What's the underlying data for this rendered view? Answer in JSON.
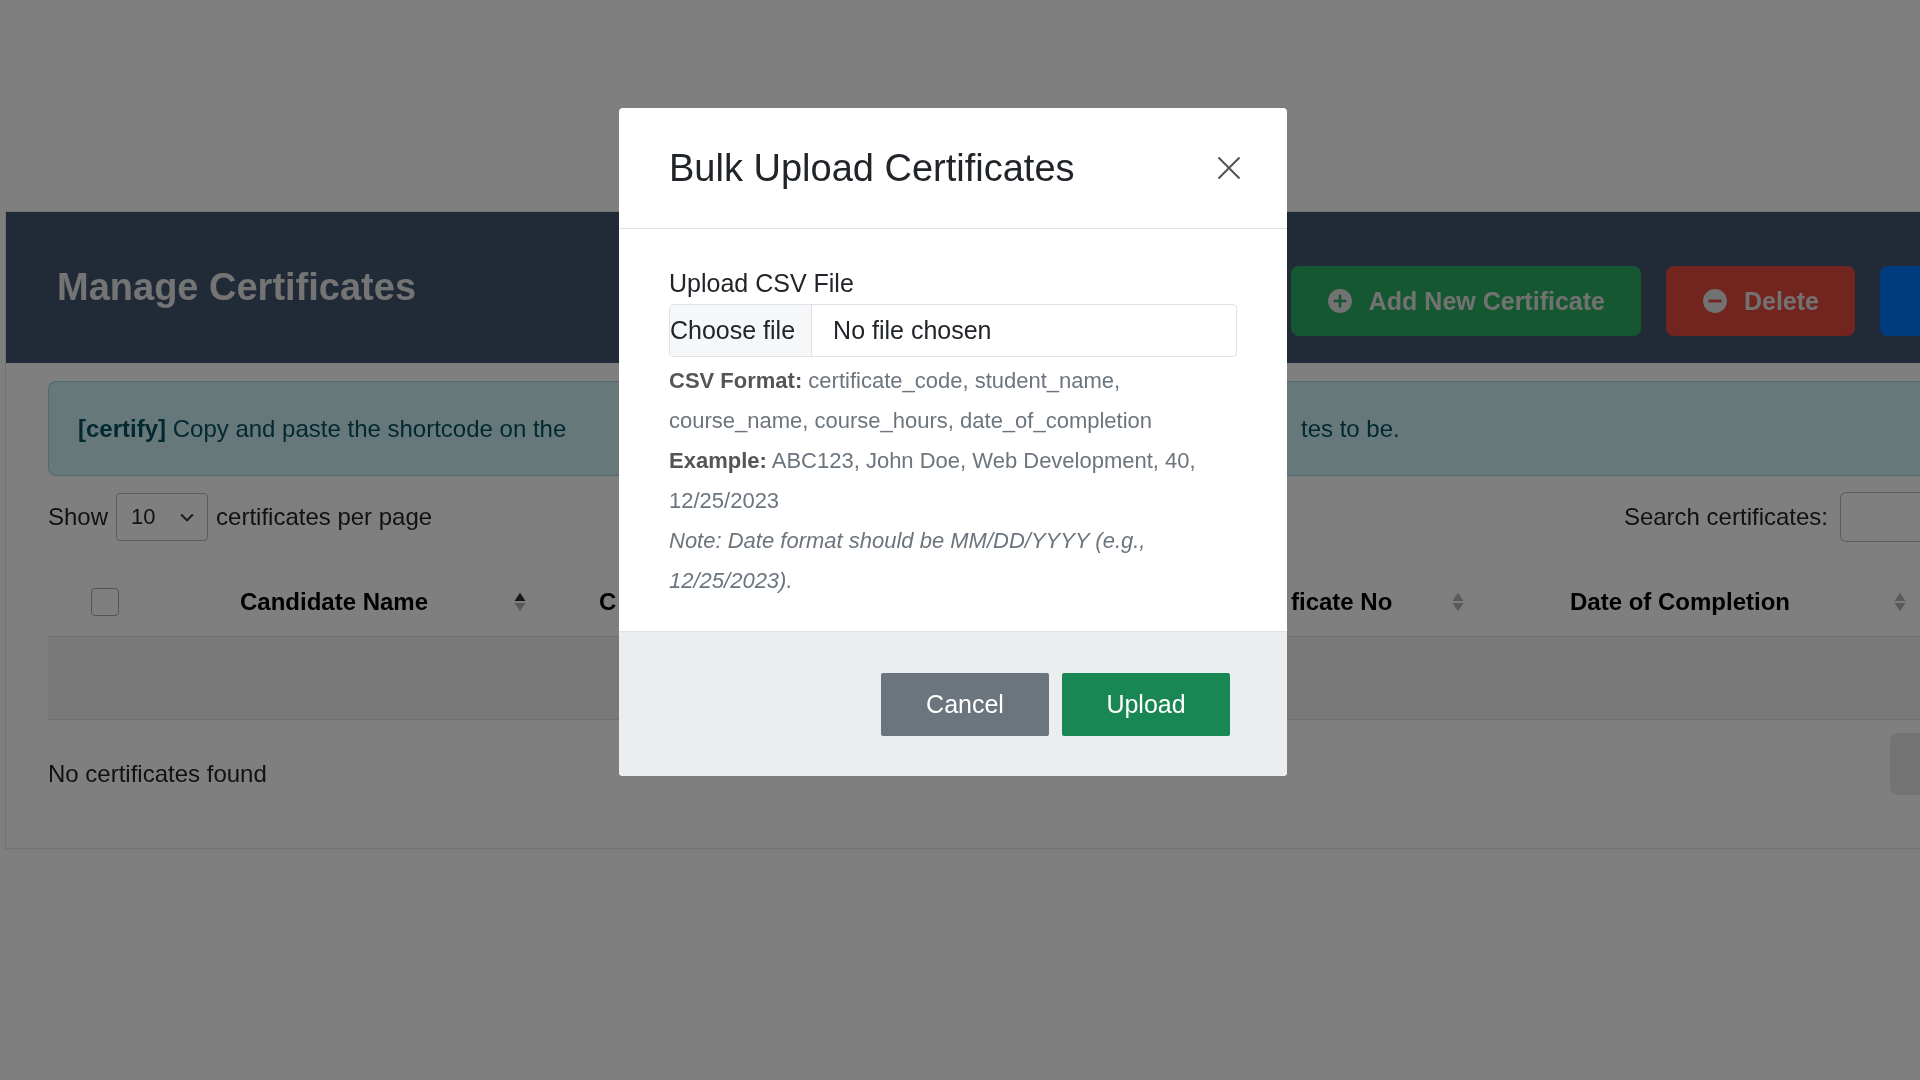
{
  "page": {
    "title": "Manage Certificates",
    "actions": [
      {
        "kind": "add",
        "label": "Add New Certificate"
      },
      {
        "kind": "delete",
        "label": "Delete"
      },
      {
        "kind": "upload"
      }
    ]
  },
  "notice": {
    "parts": [
      "**[certify]** Copy and paste the shortcode on the",
      "tes to be."
    ]
  },
  "length_menu": {
    "before": "Show",
    "value": "10",
    "after": "certificates per page"
  },
  "search": {
    "label": "Search certificates:"
  },
  "table": {
    "select_all": {
      "checked": false
    },
    "columns": [
      {
        "label": "Candidate Name",
        "sorted": true
      },
      {
        "label": "C"
      },
      {
        "label": "ficate No",
        "sorted": false
      },
      {
        "label": "Date of Completion",
        "sorted": false
      }
    ],
    "empty_message": "No certificates found"
  },
  "pagination": {
    "visible": true
  },
  "modal": {
    "title": "Bulk Upload Certificates",
    "field_label": "Upload CSV File",
    "file_button": "Choose file",
    "file_status": "No file chosen",
    "help": [
      "**CSV Format:** certificate_code, student_name, course_name, course_hours, date_of_completion",
      "**Example:** ABC123, John Doe, Web Development, 40, 12/25/2023"
    ],
    "note": "Note: Date format should be MM/DD/YYYY (e.g., 12/25/2023).",
    "buttons": [
      {
        "kind": "secondary",
        "label": "Cancel"
      },
      {
        "kind": "primary",
        "label": "Upload"
      }
    ]
  }
}
